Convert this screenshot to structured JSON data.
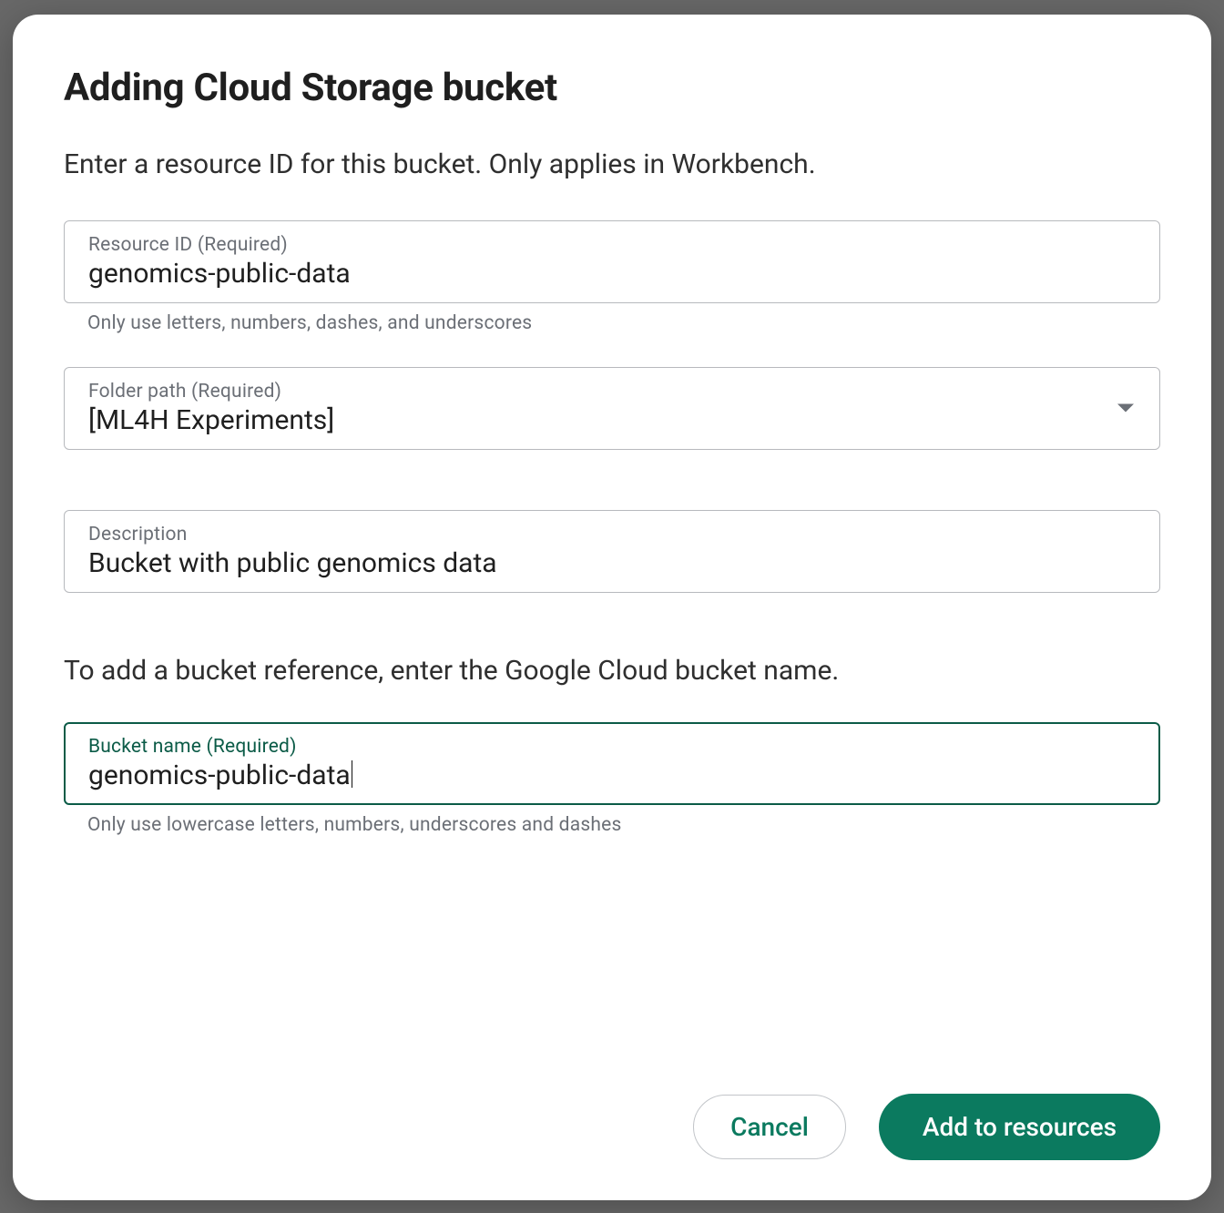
{
  "dialog": {
    "title": "Adding Cloud Storage bucket",
    "intro": "Enter a resource ID for this bucket. Only applies in Workbench.",
    "resource_id": {
      "label": "Resource ID (Required)",
      "value": "genomics-public-data",
      "helper": "Only use letters, numbers, dashes, and underscores"
    },
    "folder_path": {
      "label": "Folder path (Required)",
      "value": "[ML4H Experiments]"
    },
    "description": {
      "label": "Description",
      "value": "Bucket with public genomics data"
    },
    "bucket_name": {
      "intro": "To add a bucket reference, enter the Google Cloud bucket name.",
      "label": "Bucket name (Required)",
      "value": "genomics-public-data",
      "helper": "Only use lowercase letters, numbers, underscores and dashes"
    },
    "buttons": {
      "cancel": "Cancel",
      "add": "Add to resources"
    }
  },
  "colors": {
    "accent": "#0b7a5f",
    "focus_border": "#0b5b47",
    "field_border": "#b7b9bd",
    "muted_text": "#6b6f76"
  }
}
